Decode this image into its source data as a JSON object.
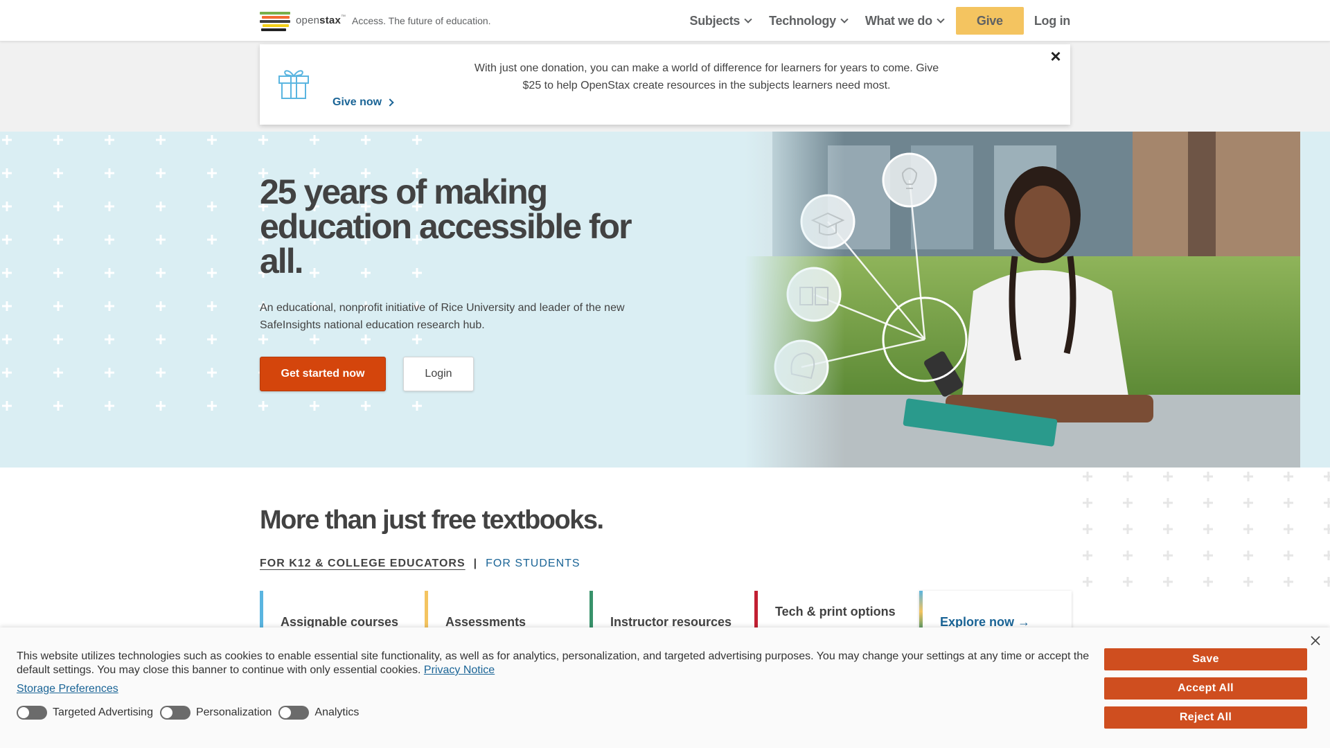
{
  "header": {
    "logo_text_open": "open",
    "logo_text_stax": "stax",
    "logo_tm": "™",
    "tagline": "Access. The future of education.",
    "nav": {
      "subjects": "Subjects",
      "technology": "Technology",
      "what_we_do": "What we do",
      "give": "Give",
      "login": "Log in"
    }
  },
  "donation": {
    "message": "With just one donation, you can make a world of difference for learners for years to come. Give $25 to help OpenStax create resources in the subjects learners need most.",
    "give_now": "Give now",
    "close": "×"
  },
  "hero": {
    "title": "25 years of making education accessible for all.",
    "subtitle": "An educational, nonprofit initiative of Rice University and leader of the new SafeInsights national education research hub.",
    "primary_button": "Get started now",
    "secondary_button": "Login"
  },
  "section2": {
    "title": "More than just free textbooks.",
    "tabs": [
      "FOR K12 & COLLEGE EDUCATORS",
      "FOR STUDENTS"
    ],
    "tab_separator": "|",
    "cards": [
      {
        "label": "Assignable courses",
        "color": "#5ab5e0"
      },
      {
        "label": "Assessments",
        "color": "#f4c460"
      },
      {
        "label": "Instructor resources",
        "color": "#38926b"
      },
      {
        "label": "Tech & print options",
        "color": "#c22032"
      }
    ],
    "explore": "Explore now →"
  },
  "cookie": {
    "text": "This website utilizes technologies such as cookies to enable essential site functionality, as well as for analytics, personalization, and targeted advertising purposes. You may change your settings at any time or accept the default settings. You may close this banner to continue with only essential cookies.",
    "privacy_link": "Privacy Notice",
    "storage_link": "Storage Preferences",
    "toggles": [
      "Targeted Advertising",
      "Personalization",
      "Analytics"
    ],
    "buttons": {
      "save": "Save",
      "accept": "Accept All",
      "reject": "Reject All"
    }
  },
  "colors": {
    "accent_orange": "#d4450c",
    "give_yellow": "#f4c460",
    "link_blue": "#1a6496",
    "hero_bg": "#daeef3"
  }
}
